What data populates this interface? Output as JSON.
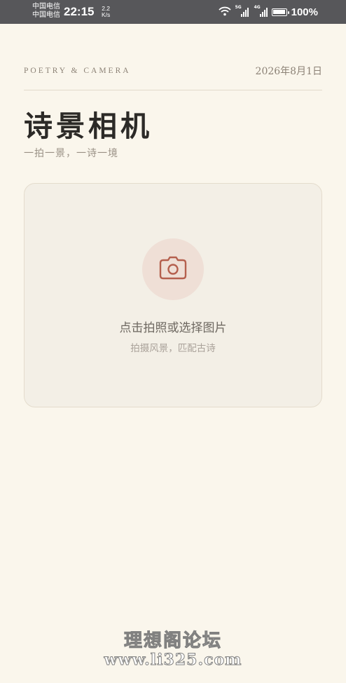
{
  "status_bar": {
    "carrier_1": "中国电信",
    "carrier_2": "中国电信",
    "time": "22:15",
    "net_speed_value": "2.2",
    "net_speed_unit": "K/s",
    "sim1_tag": "5G",
    "sim2_tag": "4G",
    "battery_percent": "100%",
    "icons": [
      "wifi-icon",
      "signal-icon",
      "signal-icon",
      "battery-icon"
    ]
  },
  "header": {
    "kicker": "POETRY & CAMERA",
    "date": "2026年8月1日",
    "title": "诗景相机",
    "subtitle": "一拍一景，一诗一境"
  },
  "upload": {
    "icon": "camera-icon",
    "title": "点击拍照或选择图片",
    "subtitle": "拍摄风景，匹配古诗"
  },
  "watermark": {
    "line1": "理想阁论坛",
    "line2": "www.li325.com"
  },
  "colors": {
    "background": "#faf6ec",
    "status_bar": "#57575a",
    "accent": "#b5604e",
    "card": "#f3efe6",
    "icon_circle": "#efdfd6"
  }
}
